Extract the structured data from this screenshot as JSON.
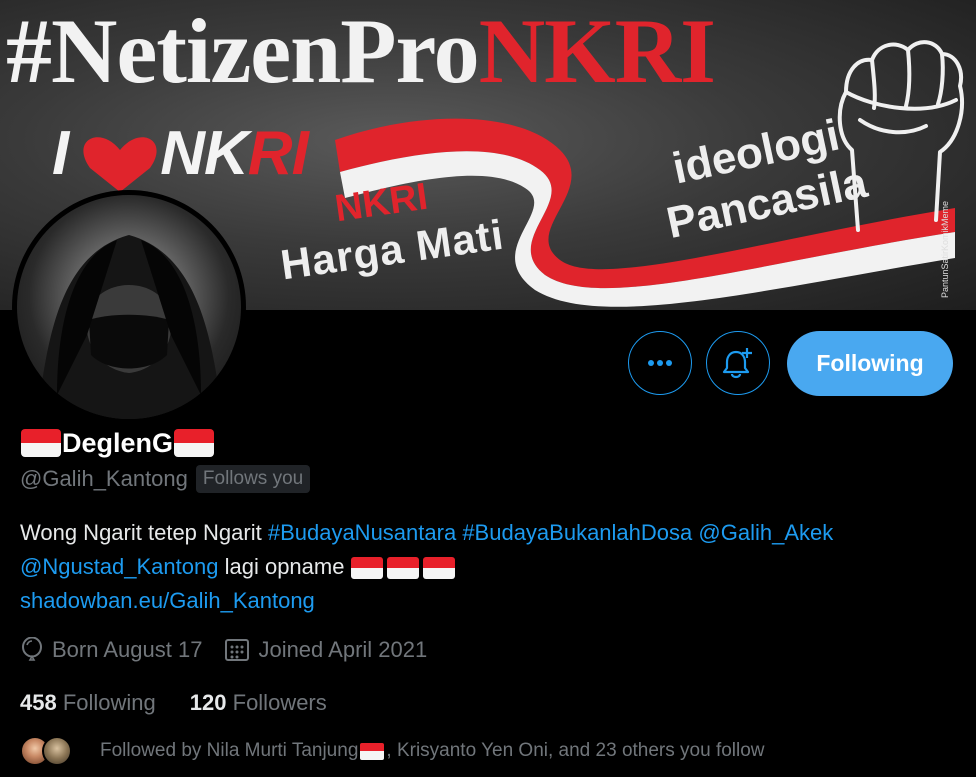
{
  "banner": {
    "hashtag_main": "#NetizenPro",
    "hashtag_accent": "NKRI",
    "love_prefix": "I",
    "love_suffix_white": "NK",
    "love_suffix_red": "RI",
    "ribbon_left_top": "NKRI",
    "ribbon_left_bottom": "Harga Mati",
    "ribbon_right_top": "ideologi",
    "ribbon_right_bottom": "Pancasila",
    "credit": "PantunSatirKomikMeme"
  },
  "actions": {
    "more_label": "More",
    "notify_label": "Turn on notifications",
    "following_label": "Following"
  },
  "profile": {
    "display_name": "DeglenG",
    "handle": "@Galih_Kantong",
    "follows_you": "Follows you",
    "bio": {
      "text1": "Wong Ngarit tetep Ngarit ",
      "tag1": "#BudayaNusantara",
      "sp1": " ",
      "tag2": "#BudayaBukanlahDosa",
      "sp2": " ",
      "mention1": "@Galih_Akek",
      "mention2": "@Ngustad_Kantong",
      "text2": " lagi opname ",
      "url": "shadowban.eu/Galih_Kantong"
    },
    "born": "Born August 17",
    "joined": "Joined April 2021",
    "following_count": "458",
    "following_label": "Following",
    "followers_count": "120",
    "followers_label": "Followers",
    "followed_by_prefix": "Followed by Nila Murti Tanjung",
    "followed_by_suffix": ", Krisyanto Yen Oni, and 23 others you follow"
  },
  "colors": {
    "accent": "#1d9bf0",
    "following_button": "#49a8f0",
    "flag_red": "#e8202a",
    "muted_text": "#71767b",
    "background": "#000000"
  }
}
